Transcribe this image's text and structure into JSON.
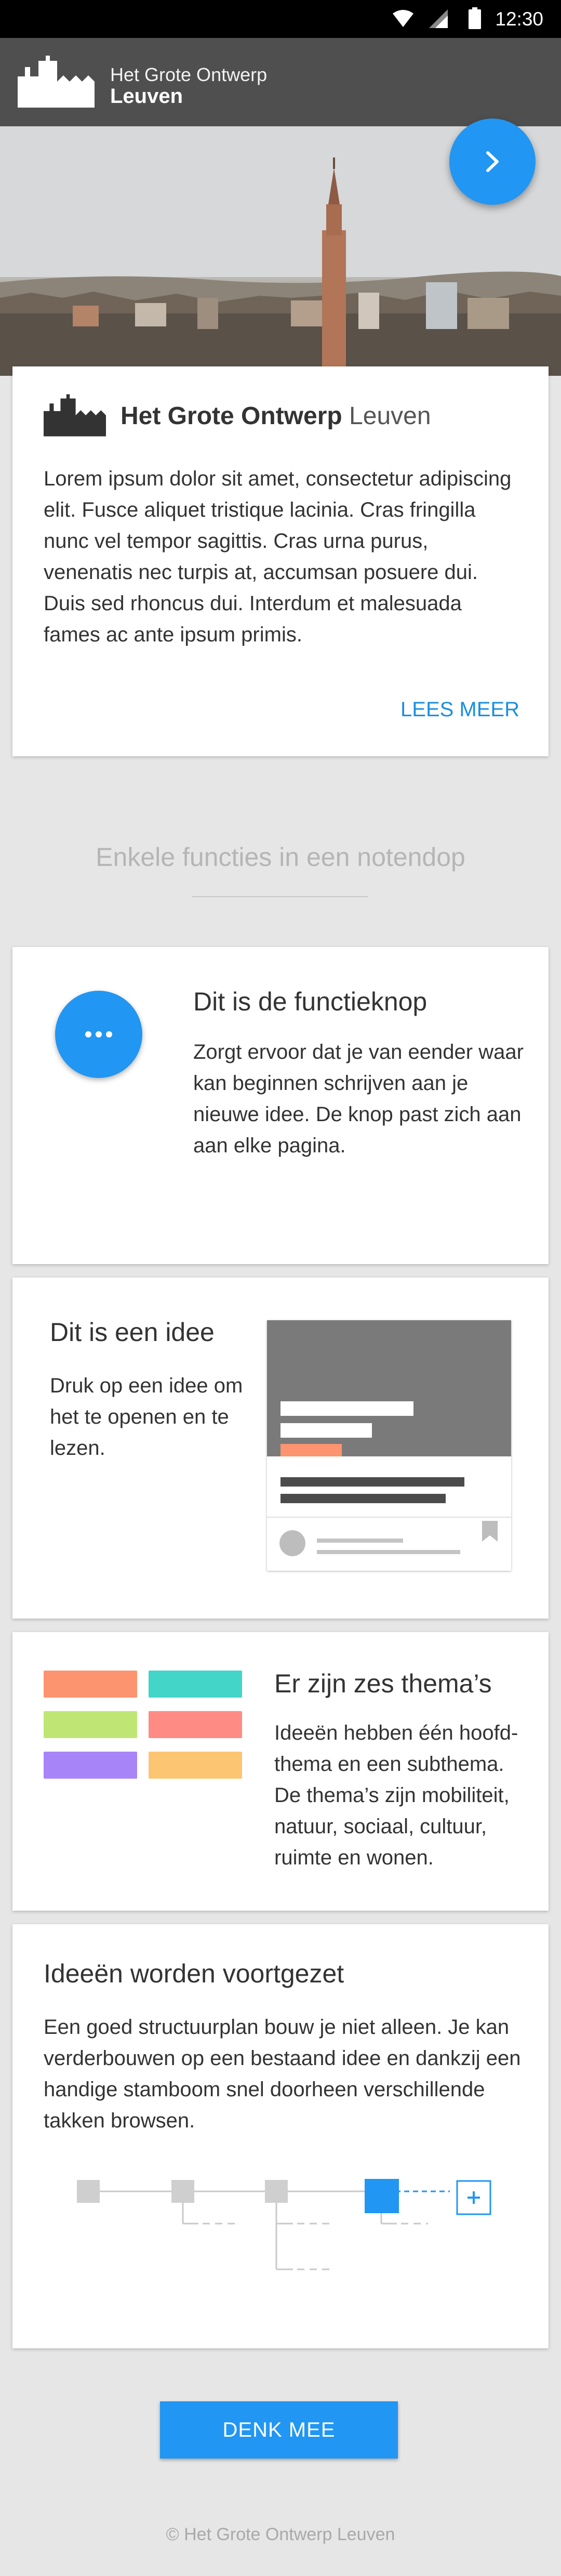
{
  "status_bar": {
    "time": "12:30"
  },
  "app_bar": {
    "title_line1": "Het Grote Ontwerp",
    "title_line2": "Leuven"
  },
  "intro_card": {
    "title_bold": "Het Grote Ontwerp",
    "title_light": "Leuven",
    "body": "Lorem ipsum dolor sit amet, consectetur adipiscing elit. Fusce aliquet tristique lacinia. Cras fringilla nunc vel tempor sagittis. Cras urna purus, venenatis nec turpis at, accumsan posuere dui. Duis sed rhoncus dui. Interdum et malesuada fames ac ante ipsum primis.",
    "link": "LEES MEER"
  },
  "section": {
    "title": "Enkele functies in een notendop"
  },
  "feature_button": {
    "title": "Dit is de functieknop",
    "body": "Zorgt ervoor dat je van eender waar kan beginnen schrijven aan je nieuwe idee. De knop past zich aan aan elke pagina."
  },
  "feature_idea": {
    "title": "Dit is een idee",
    "body": "Druk op een idee om het te openen en te lezen."
  },
  "feature_themes": {
    "title": "Er zijn zes thema’s",
    "body": "Ideeën hebben één hoofd-thema en een subthema. De thema’s zijn mobiliteit, natuur, sociaal, cultuur, ruimte en wonen.",
    "colors": [
      "#fc946f",
      "#42d5c8",
      "#bfe675",
      "#fe8c85",
      "#a784f7",
      "#fcc572"
    ]
  },
  "feature_tree": {
    "title": "Ideeën worden voortgezet",
    "body": "Een goed structuurplan bouw je niet alleen. Je kan verderbouwen op een bestaand idee en dankzij een handige stamboom snel doorheen verschillende takken browsen."
  },
  "cta": {
    "label": "DENK MEE"
  },
  "footer": {
    "text": "© Het Grote Ontwerp Leuven"
  },
  "colors": {
    "accent": "#2196f3",
    "link": "#1a8fe0",
    "appbar": "#4f4f4f"
  },
  "icons": [
    "wifi-icon",
    "signal-icon",
    "battery-icon",
    "city-logo-icon",
    "arrow-right-icon",
    "more-dots-icon",
    "bookmark-icon",
    "plus-icon"
  ]
}
